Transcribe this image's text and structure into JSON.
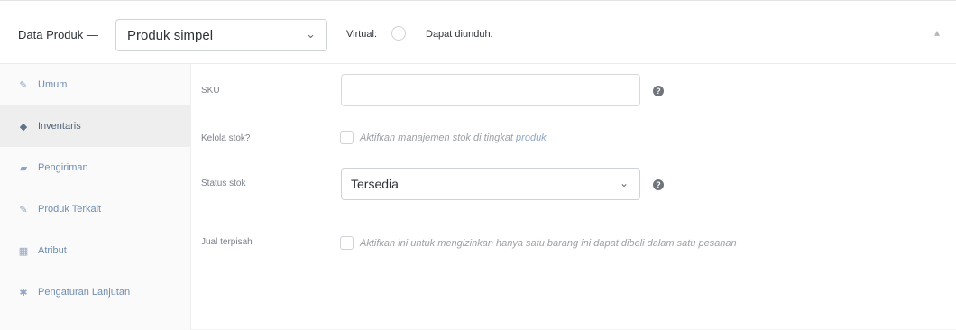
{
  "header": {
    "title": "Data Produk —",
    "product_type": "Produk simpel",
    "product_type_chevron": "chevron-down-icon",
    "virtual_label": "Virtual:",
    "downloadable_label": "Dapat diunduh:",
    "collapse_icon": "caret-up-icon"
  },
  "sidebar": {
    "items": [
      {
        "label": "Umum",
        "icon": "wrench-icon",
        "glyph": "✎"
      },
      {
        "label": "Inventaris",
        "icon": "diamond-icon",
        "glyph": "◆"
      },
      {
        "label": "Pengiriman",
        "icon": "truck-icon",
        "glyph": "▰"
      },
      {
        "label": "Produk Terkait",
        "icon": "link-icon",
        "glyph": "✎"
      },
      {
        "label": "Atribut",
        "icon": "table-icon",
        "glyph": "▦"
      },
      {
        "label": "Pengaturan Lanjutan",
        "icon": "gear-icon",
        "glyph": "✱"
      }
    ]
  },
  "inventory": {
    "sku_label": "SKU",
    "sku_value": "",
    "manage_stock_label": "Kelola stok?",
    "manage_stock_desc": "Aktifkan manajemen stok di tingkat",
    "manage_stock_link": "produk",
    "stock_status_label": "Status stok",
    "stock_status_value": "Tersedia",
    "sold_individually_label": "Jual terpisah",
    "sold_individually_desc": "Aktifkan ini untuk mengizinkan hanya satu barang ini dapat dibeli dalam satu pesanan"
  }
}
